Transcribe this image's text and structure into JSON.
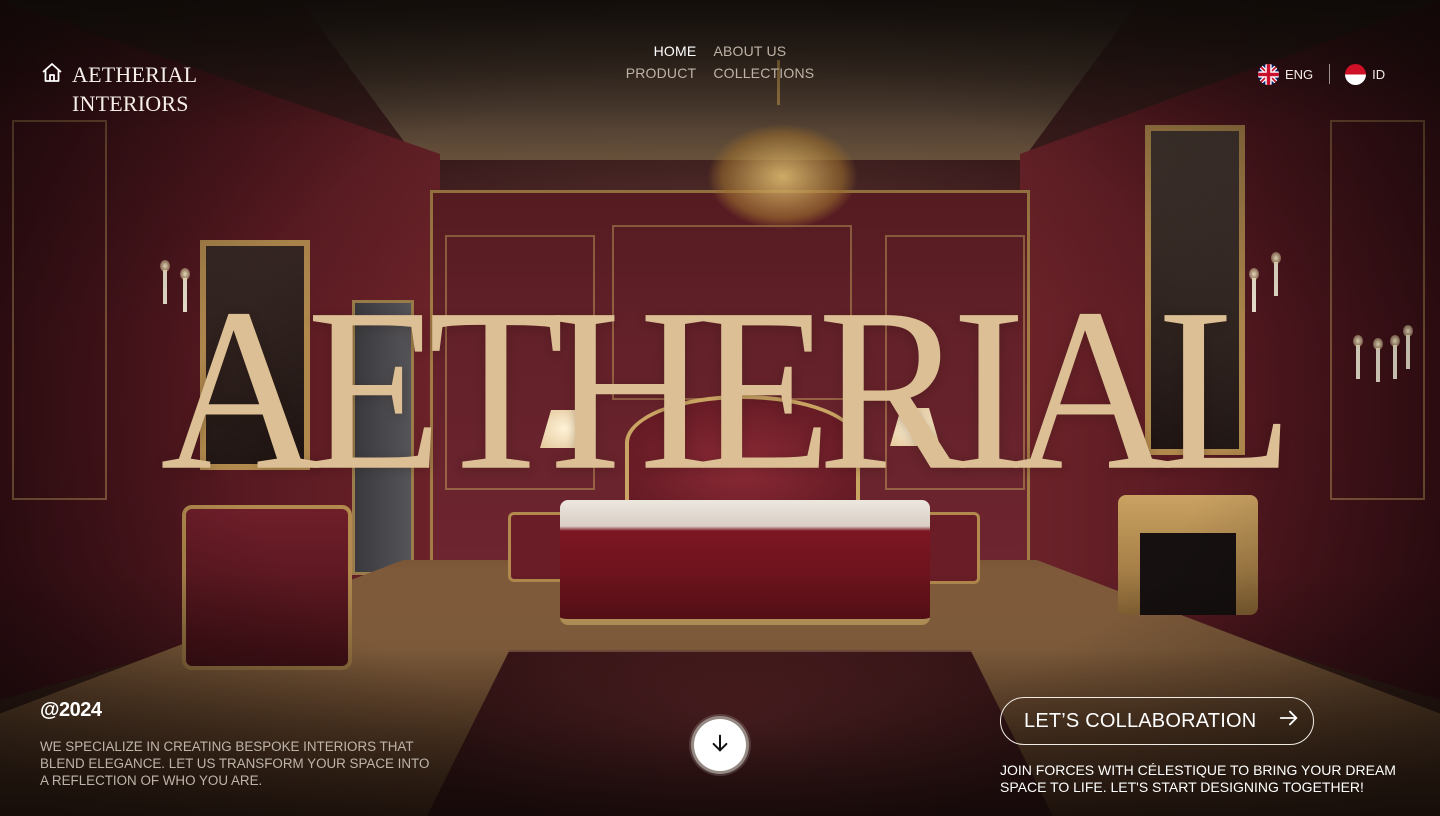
{
  "brand": {
    "line1": "AETHERIAL",
    "line2": "INTERIORS",
    "icon": "home-icon"
  },
  "nav": {
    "items": [
      {
        "label": "HOME",
        "active": true
      },
      {
        "label": "ABOUT US",
        "active": false
      },
      {
        "label": "PRODUCT",
        "active": false
      },
      {
        "label": "COLLECTIONS",
        "active": false
      }
    ]
  },
  "language": {
    "options": [
      {
        "label": "ENG",
        "icon": "uk-flag-icon"
      },
      {
        "label": "ID",
        "icon": "indonesia-flag-icon"
      }
    ]
  },
  "hero": {
    "title": "AETHERIAL"
  },
  "footer_left": {
    "year": "@2024",
    "description": "WE SPECIALIZE IN CREATING BESPOKE INTERIORS THAT BLEND ELEGANCE. LET US TRANSFORM YOUR SPACE INTO A REFLECTION OF WHO YOU ARE."
  },
  "scroll": {
    "icon": "arrow-down-icon"
  },
  "cta": {
    "label": "LET’S COLLABORATION",
    "icon": "arrow-right-icon",
    "subtext": "JOIN FORCES WITH CÉLESTIQUE TO BRING YOUR DREAM SPACE TO LIFE. LET'S START DESIGNING TOGETHER!"
  },
  "colors": {
    "hero_text": "#dcbf94",
    "wall": "#5a1a22",
    "gold": "#b28a4e",
    "text_light": "#f3ece4"
  }
}
